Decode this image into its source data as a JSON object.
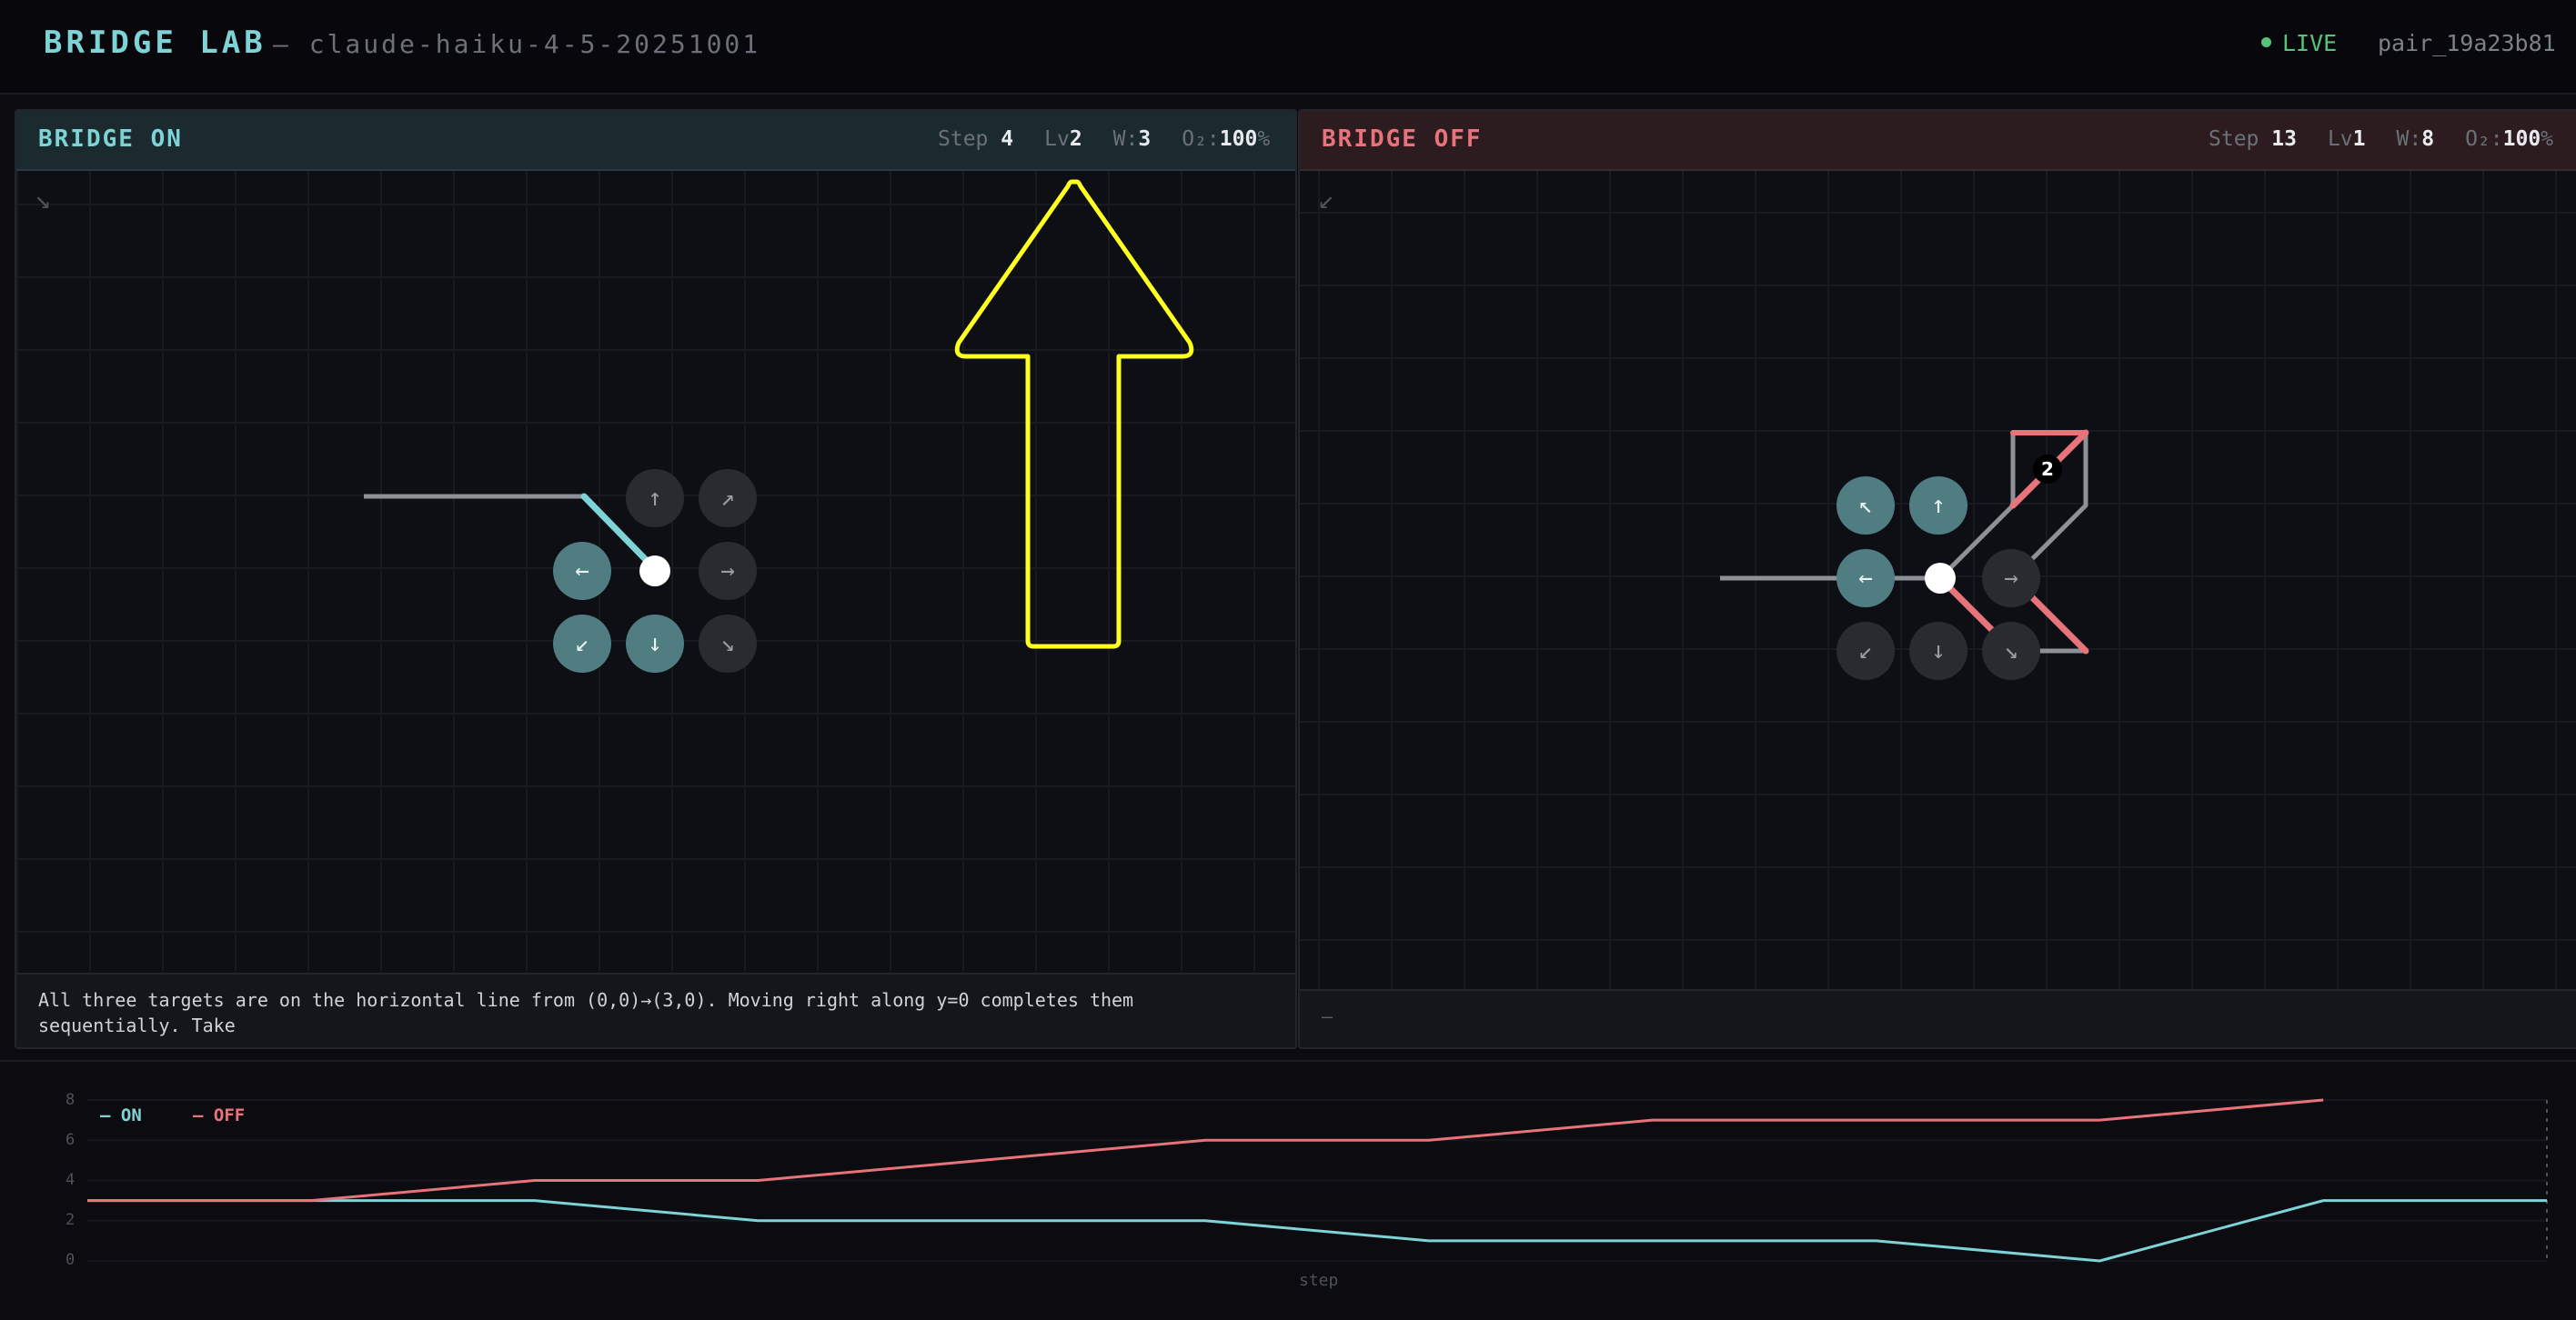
{
  "header": {
    "brand": "BRIDGE LAB",
    "model": "— claude-haiku-4-5-20251001",
    "live_label": "LIVE",
    "pair_id": "pair_19a23b81"
  },
  "panels": {
    "on": {
      "title": "BRIDGE ON",
      "step_label": "Step",
      "step_value": "4",
      "lv_label": "Lv",
      "lv_value": "2",
      "w_label": "W:",
      "w_value": "3",
      "o2_label": "O₂:",
      "o2_value": "100",
      "o2_unit": "%",
      "corner_icon": "↘",
      "note": "All three targets are on the horizontal line from (0,0)→(3,0). Moving right along y=0 completes them sequentially. Take"
    },
    "off": {
      "title": "BRIDGE OFF",
      "step_label": "Step",
      "step_value": "13",
      "lv_label": "Lv",
      "lv_value": "1",
      "w_label": "W:",
      "w_value": "8",
      "o2_label": "O₂:",
      "o2_value": "100",
      "o2_unit": "%",
      "corner_icon": "↙",
      "target_badge": "2",
      "note": "—"
    }
  },
  "direction_buttons": {
    "on": [
      {
        "name": "up",
        "glyph": "↑",
        "state": "idle"
      },
      {
        "name": "up-right",
        "glyph": "↗",
        "state": "idle"
      },
      {
        "name": "left",
        "glyph": "←",
        "state": "active"
      },
      {
        "name": "right",
        "glyph": "→",
        "state": "idle"
      },
      {
        "name": "down-left",
        "glyph": "↙",
        "state": "active"
      },
      {
        "name": "down",
        "glyph": "↓",
        "state": "active"
      },
      {
        "name": "down-right",
        "glyph": "↘",
        "state": "idle"
      }
    ],
    "off": [
      {
        "name": "up-left",
        "glyph": "↖",
        "state": "active"
      },
      {
        "name": "up",
        "glyph": "↑",
        "state": "active"
      },
      {
        "name": "left",
        "glyph": "←",
        "state": "active"
      },
      {
        "name": "right",
        "glyph": "→",
        "state": "idle"
      },
      {
        "name": "down-left",
        "glyph": "↙",
        "state": "idle"
      },
      {
        "name": "down",
        "glyph": "↓",
        "state": "idle"
      },
      {
        "name": "down-right",
        "glyph": "↘",
        "state": "idle"
      }
    ]
  },
  "colors": {
    "on": "#7ed3d6",
    "off": "#e8737a",
    "highlight_arrow": "#ffff22",
    "live": "#58c27b"
  },
  "chart_data": {
    "type": "line",
    "x": [
      0,
      1,
      2,
      3,
      4,
      5,
      6,
      7,
      8,
      9,
      10,
      11
    ],
    "xlabel": "step",
    "ylim": [
      0,
      8
    ],
    "yticks": [
      "0",
      "2",
      "4",
      "6",
      "8"
    ],
    "legend": "top-left",
    "series": [
      {
        "name": "ON",
        "values": [
          3,
          3,
          3,
          2,
          2,
          2,
          1,
          1,
          1,
          0,
          3,
          3
        ]
      },
      {
        "name": "OFF",
        "values": [
          3,
          3,
          4,
          4,
          5,
          6,
          6,
          7,
          7,
          7,
          8,
          null
        ]
      }
    ],
    "legend_labels": {
      "on": "— ON",
      "off": "— OFF"
    }
  }
}
